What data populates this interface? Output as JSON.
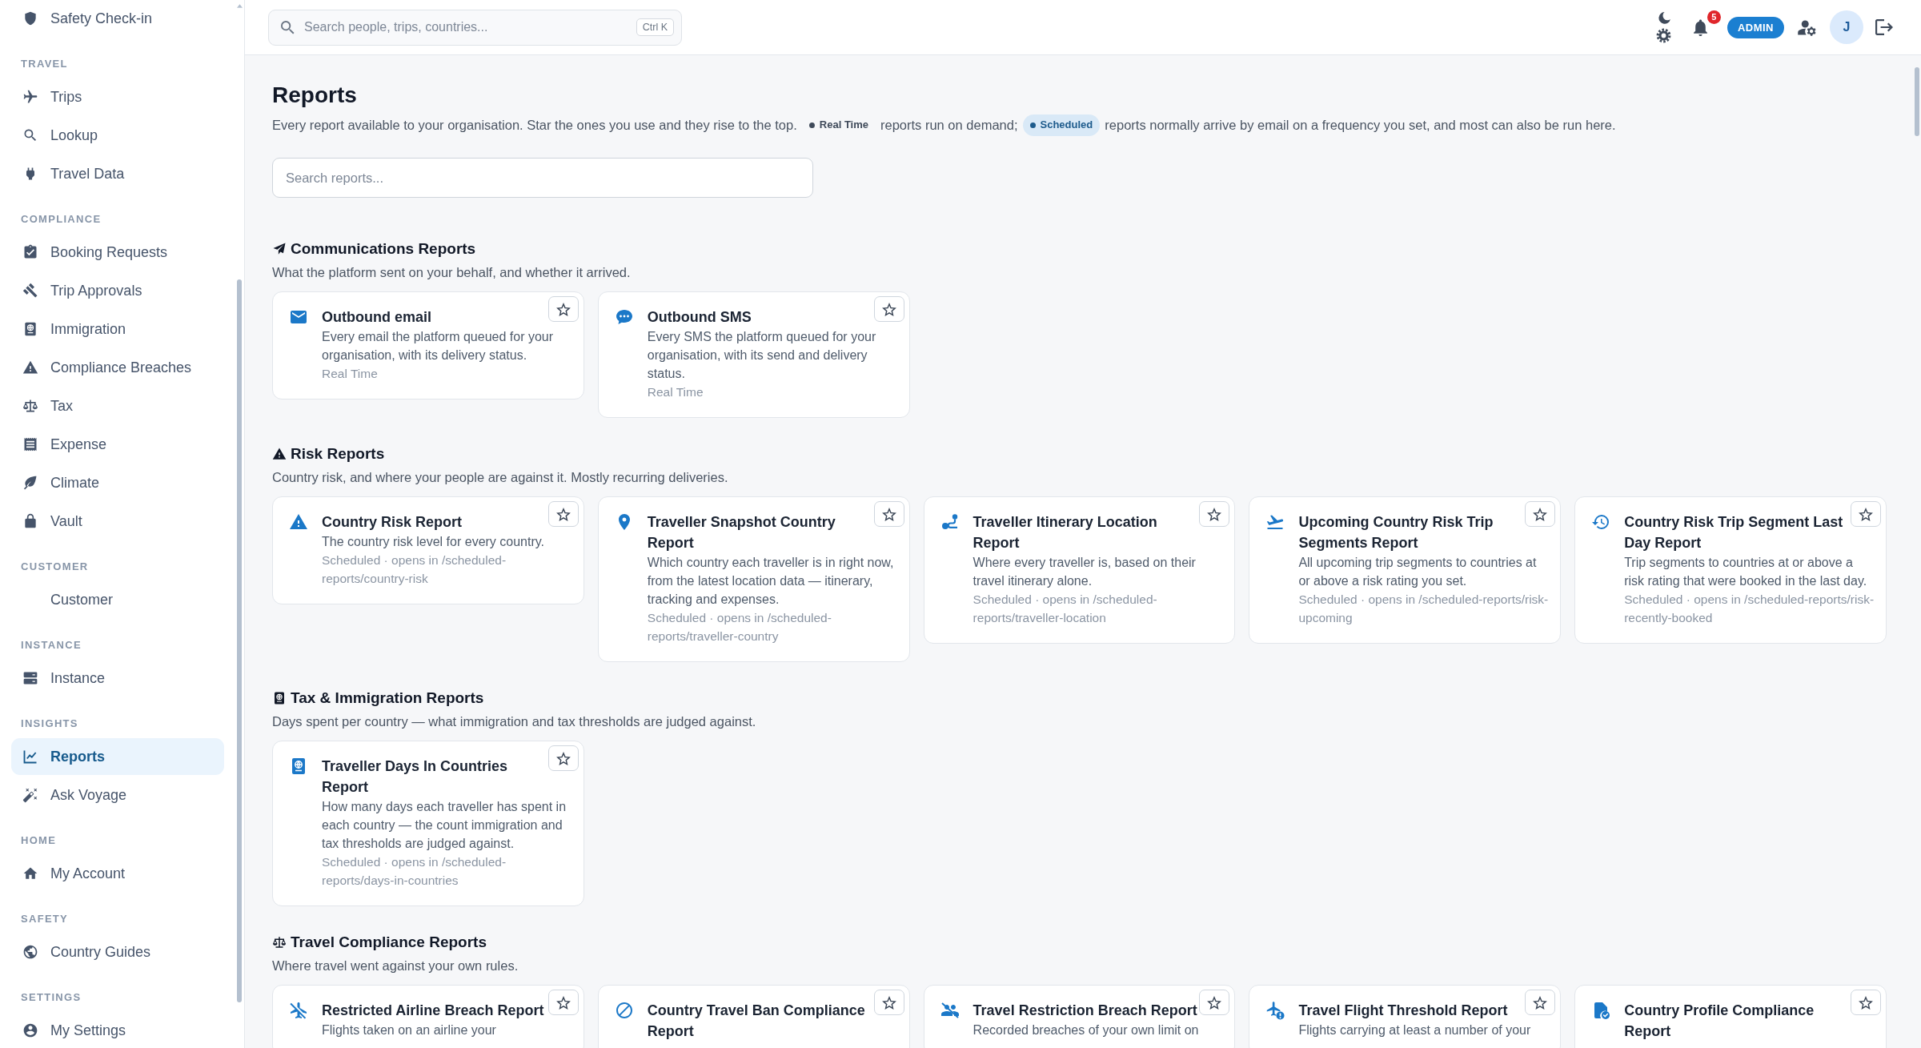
{
  "sidebar": {
    "sections": [
      {
        "items": [
          {
            "label": "Safety Check-in",
            "selected": false
          }
        ]
      },
      {
        "heading": "TRAVEL",
        "items": [
          {
            "label": "Trips",
            "selected": false
          },
          {
            "label": "Lookup",
            "selected": false
          },
          {
            "label": "Travel Data",
            "selected": false
          }
        ]
      },
      {
        "heading": "COMPLIANCE",
        "items": [
          {
            "label": "Booking Requests",
            "selected": false
          },
          {
            "label": "Trip Approvals",
            "selected": false
          },
          {
            "label": "Immigration",
            "selected": false
          },
          {
            "label": "Compliance Breaches",
            "selected": false
          },
          {
            "label": "Tax",
            "selected": false
          },
          {
            "label": "Expense",
            "selected": false
          },
          {
            "label": "Climate",
            "selected": false
          },
          {
            "label": "Vault",
            "selected": false
          }
        ]
      },
      {
        "heading": "CUSTOMER",
        "items": [
          {
            "label": "Customer",
            "selected": false
          }
        ]
      },
      {
        "heading": "INSTANCE",
        "items": [
          {
            "label": "Instance",
            "selected": false
          }
        ]
      },
      {
        "heading": "INSIGHTS",
        "items": [
          {
            "label": "Reports",
            "selected": true
          },
          {
            "label": "Ask Voyage",
            "selected": false
          }
        ]
      },
      {
        "heading": "HOME",
        "items": [
          {
            "label": "My Account",
            "selected": false
          }
        ]
      },
      {
        "heading": "SAFETY",
        "items": [
          {
            "label": "Country Guides",
            "selected": false
          }
        ]
      },
      {
        "heading": "SETTINGS",
        "items": [
          {
            "label": "My Settings",
            "selected": false
          }
        ]
      }
    ]
  },
  "topbar": {
    "search": {
      "placeholder": "Search people, trips, countries...",
      "shortcut": "Ctrl K"
    },
    "notifications": "5",
    "role": "ADMIN",
    "avatar_initial": "J"
  },
  "page": {
    "title": "Reports",
    "intro": [
      {
        "kind": "text",
        "text": "Every report available to your organisation. Star the ones you use and they rise to the top."
      },
      {
        "kind": "badge",
        "text": "Real Time",
        "highlighted": false
      },
      {
        "kind": "text",
        "text": "reports run on demand;"
      },
      {
        "kind": "badge",
        "text": "Scheduled",
        "highlighted": true
      },
      {
        "kind": "text",
        "text": "reports normally arrive by email on a frequency you set, and most can also be run here."
      }
    ],
    "search": {
      "placeholder": "Search reports..."
    },
    "sections": [
      {
        "title": "Communications Reports",
        "description": "What the platform sent on your behalf, and whether it arrived.",
        "reports": [
          {
            "title": "Outbound email",
            "description": "Every email the platform queued for your organisation, with its delivery status.",
            "meta": "Real Time",
            "starred": false
          },
          {
            "title": "Outbound SMS",
            "description": "Every SMS the platform queued for your organisation, with its send and delivery status.",
            "meta": "Real Time",
            "starred": false
          }
        ]
      },
      {
        "title": "Risk Reports",
        "description": "Country risk, and where your people are against it. Mostly recurring deliveries.",
        "reports": [
          {
            "title": "Country Risk Report",
            "description": "The country risk level for every country.",
            "meta": "Scheduled · opens in /scheduled-reports/country-risk",
            "starred": false
          },
          {
            "title": "Traveller Snapshot Country Report",
            "description": "Which country each traveller is in right now, from the latest location data — itinerary, tracking and expenses.",
            "meta": "Scheduled · opens in /scheduled-reports/traveller-country",
            "starred": false
          },
          {
            "title": "Traveller Itinerary Location Report",
            "description": "Where every traveller is, based on their travel itinerary alone.",
            "meta": "Scheduled · opens in /scheduled-reports/traveller-location",
            "starred": false
          },
          {
            "title": "Upcoming Country Risk Trip Segments Report",
            "description": "All upcoming trip segments to countries at or above a risk rating you set.",
            "meta": "Scheduled · opens in /scheduled-reports/risk-upcoming",
            "starred": false
          },
          {
            "title": "Country Risk Trip Segment Last Day Report",
            "description": "Trip segments to countries at or above a risk rating that were booked in the last day.",
            "meta": "Scheduled · opens in /scheduled-reports/risk-recently-booked",
            "starred": false
          }
        ]
      },
      {
        "title": "Tax & Immigration Reports",
        "description": "Days spent per country — what immigration and tax thresholds are judged against.",
        "reports": [
          {
            "title": "Traveller Days In Countries Report",
            "description": "How many days each traveller has spent in each country — the count immigration and tax thresholds are judged against.",
            "meta": "Scheduled · opens in /scheduled-reports/days-in-countries",
            "starred": false
          }
        ]
      },
      {
        "title": "Travel Compliance Reports",
        "description": "Where travel went against your own rules.",
        "reports": [
          {
            "title": "Restricted Airline Breach Report",
            "description": "Flights taken on an airline your",
            "starred": false
          },
          {
            "title": "Country Travel Ban Compliance Report",
            "starred": false
          },
          {
            "title": "Travel Restriction Breach Report",
            "description": "Recorded breaches of your own limit on",
            "starred": false
          },
          {
            "title": "Travel Flight Threshold Report",
            "description": "Flights carrying at least a number of your",
            "starred": false
          },
          {
            "title": "Country Profile Compliance Report",
            "starred": false
          }
        ]
      }
    ]
  }
}
